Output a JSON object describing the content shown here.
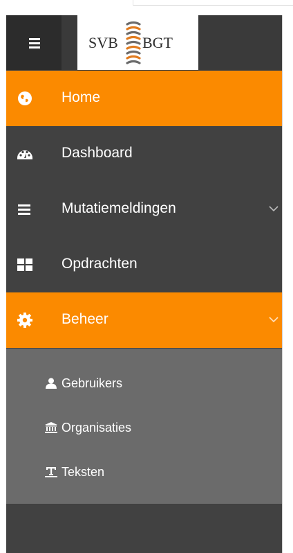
{
  "logo": {
    "left_text": "SVB",
    "right_text": "BGT"
  },
  "menu": [
    {
      "label": "Home",
      "icon": "globe-icon",
      "active": true
    },
    {
      "label": "Dashboard",
      "icon": "dashboard-icon",
      "active": false
    },
    {
      "label": "Mutatiemeldingen",
      "icon": "list-icon",
      "active": false,
      "expandable": true
    },
    {
      "label": "Opdrachten",
      "icon": "grid-icon",
      "active": false
    },
    {
      "label": "Beheer",
      "icon": "gear-icon",
      "active": true,
      "expandable": true
    }
  ],
  "submenu": [
    {
      "label": "Gebruikers",
      "icon": "user-icon"
    },
    {
      "label": "Organisaties",
      "icon": "institution-icon"
    },
    {
      "label": "Teksten",
      "icon": "text-icon"
    }
  ],
  "colors": {
    "accent": "#fb8a00",
    "sidebar_bg": "#414141",
    "submenu_bg": "#6b6b6b",
    "hamburger_bg": "#2c2c2c"
  }
}
